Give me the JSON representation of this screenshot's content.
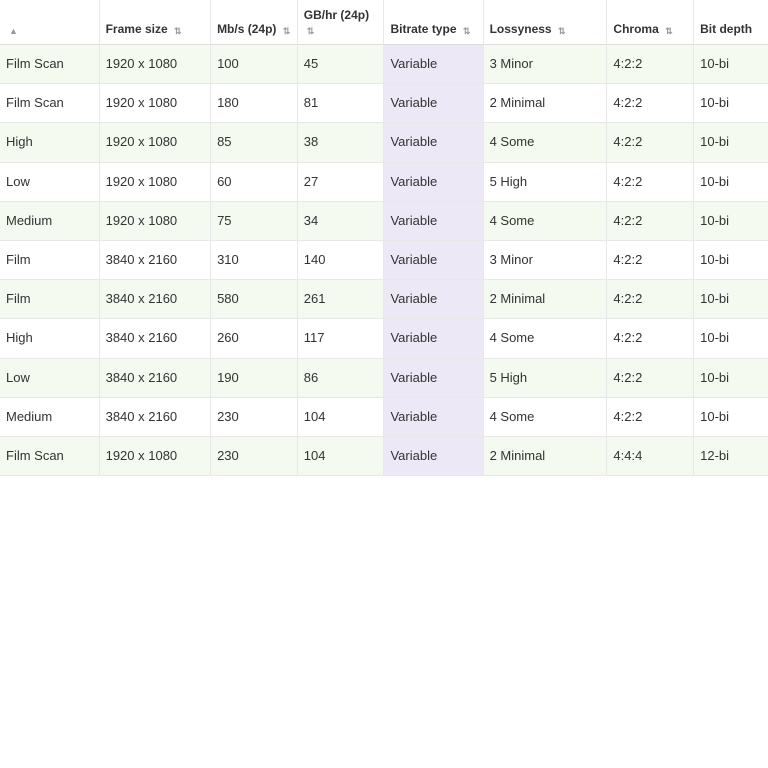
{
  "table": {
    "columns": [
      {
        "key": "name",
        "label": "",
        "sortable": true
      },
      {
        "key": "frameSize",
        "label": "Frame size",
        "sortable": true
      },
      {
        "key": "mbs",
        "label": "Mb/s (24p)",
        "sortable": true
      },
      {
        "key": "gbhr",
        "label": "GB/hr (24p)",
        "sortable": true
      },
      {
        "key": "bitrateType",
        "label": "Bitrate type",
        "sortable": true
      },
      {
        "key": "lossyness",
        "label": "Lossyness",
        "sortable": true
      },
      {
        "key": "chroma",
        "label": "Chroma",
        "sortable": true
      },
      {
        "key": "bitDepth",
        "label": "Bit depth",
        "sortable": false
      }
    ],
    "rows": [
      {
        "name": "Film Scan",
        "frameSize": "1920 x 1080",
        "mbs": "100",
        "gbhr": "45",
        "bitrateType": "Variable",
        "lossyness": "3 Minor",
        "chroma": "4:2:2",
        "bitDepth": "10-bi"
      },
      {
        "name": "Film Scan",
        "frameSize": "1920 x 1080",
        "mbs": "180",
        "gbhr": "81",
        "bitrateType": "Variable",
        "lossyness": "2 Minimal",
        "chroma": "4:2:2",
        "bitDepth": "10-bi"
      },
      {
        "name": "High",
        "frameSize": "1920 x 1080",
        "mbs": "85",
        "gbhr": "38",
        "bitrateType": "Variable",
        "lossyness": "4 Some",
        "chroma": "4:2:2",
        "bitDepth": "10-bi"
      },
      {
        "name": "Low",
        "frameSize": "1920 x 1080",
        "mbs": "60",
        "gbhr": "27",
        "bitrateType": "Variable",
        "lossyness": "5 High",
        "chroma": "4:2:2",
        "bitDepth": "10-bi"
      },
      {
        "name": "Medium",
        "frameSize": "1920 x 1080",
        "mbs": "75",
        "gbhr": "34",
        "bitrateType": "Variable",
        "lossyness": "4 Some",
        "chroma": "4:2:2",
        "bitDepth": "10-bi"
      },
      {
        "name": "Film",
        "frameSize": "3840 x 2160",
        "mbs": "310",
        "gbhr": "140",
        "bitrateType": "Variable",
        "lossyness": "3 Minor",
        "chroma": "4:2:2",
        "bitDepth": "10-bi"
      },
      {
        "name": "Film",
        "frameSize": "3840 x 2160",
        "mbs": "580",
        "gbhr": "261",
        "bitrateType": "Variable",
        "lossyness": "2 Minimal",
        "chroma": "4:2:2",
        "bitDepth": "10-bi"
      },
      {
        "name": "High",
        "frameSize": "3840 x 2160",
        "mbs": "260",
        "gbhr": "117",
        "bitrateType": "Variable",
        "lossyness": "4 Some",
        "chroma": "4:2:2",
        "bitDepth": "10-bi"
      },
      {
        "name": "Low",
        "frameSize": "3840 x 2160",
        "mbs": "190",
        "gbhr": "86",
        "bitrateType": "Variable",
        "lossyness": "5 High",
        "chroma": "4:2:2",
        "bitDepth": "10-bi"
      },
      {
        "name": "Medium",
        "frameSize": "3840 x 2160",
        "mbs": "230",
        "gbhr": "104",
        "bitrateType": "Variable",
        "lossyness": "4 Some",
        "chroma": "4:2:2",
        "bitDepth": "10-bi"
      },
      {
        "name": "Film Scan",
        "frameSize": "1920 x 1080",
        "mbs": "230",
        "gbhr": "104",
        "bitrateType": "Variable",
        "lossyness": "2 Minimal",
        "chroma": "4:4:4",
        "bitDepth": "12-bi"
      }
    ]
  }
}
